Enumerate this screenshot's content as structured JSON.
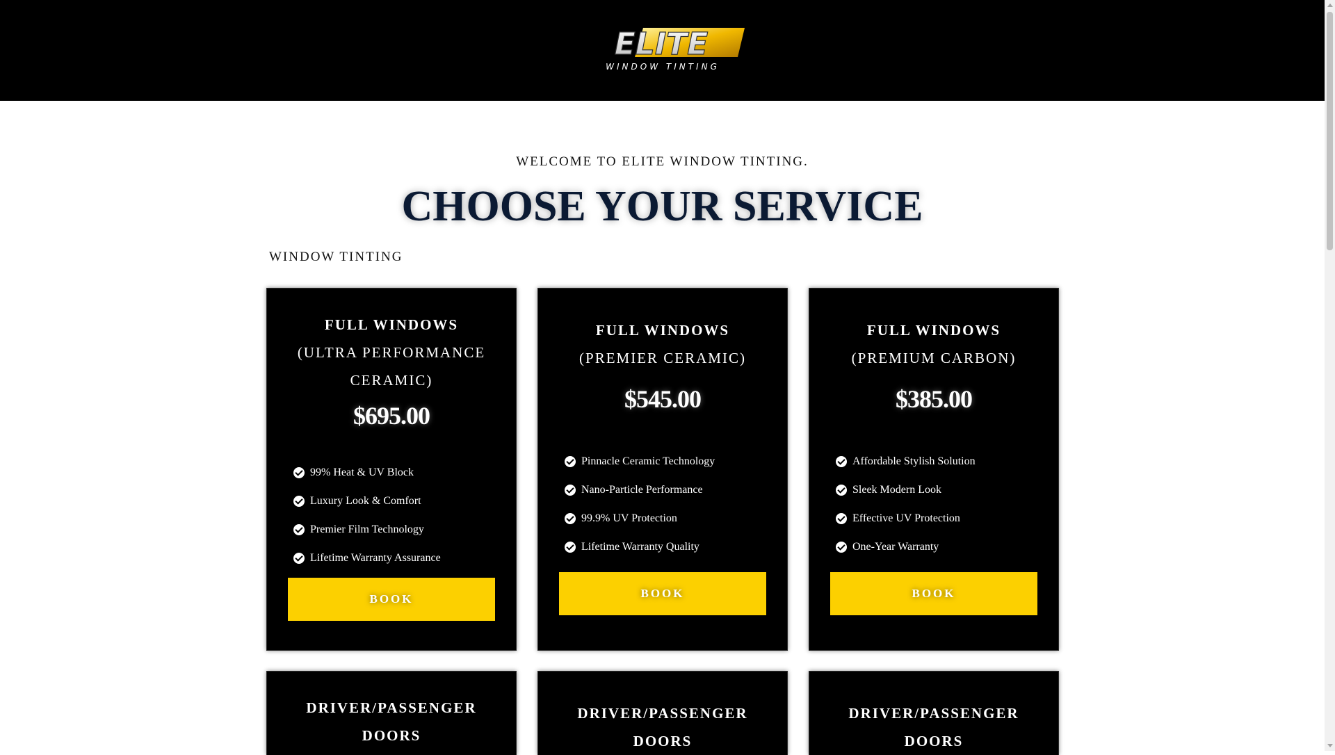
{
  "header": {
    "logo_text": "ELITE",
    "logo_subtext": "WINDOW TINTING"
  },
  "welcome": "WELCOME TO ELITE WINDOW TINTING.",
  "title": "CHOOSE YOUR SERVICE",
  "section_label": "WINDOW TINTING",
  "colors": {
    "header_bg": "#000000",
    "card_bg": "#000000",
    "button_bg": "#fcd000",
    "title_color": "#0b1a33"
  },
  "cards": [
    {
      "title": "FULL WINDOWS",
      "subtitle_line1": "(ULTRA PERFORMANCE",
      "subtitle_line2": "CERAMIC)",
      "price": "$695.00",
      "features": [
        "99% Heat & UV Block",
        "Luxury Look & Comfort",
        "Premier Film Technology",
        "Lifetime Warranty Assurance"
      ],
      "button": "BOOK"
    },
    {
      "title": "FULL WINDOWS",
      "subtitle_line1": "(PREMIER CERAMIC)",
      "price": "$545.00",
      "features": [
        "Pinnacle Ceramic Technology",
        "Nano-Particle Performance",
        "99.9% UV Protection",
        "Lifetime Warranty Quality"
      ],
      "button": "BOOK"
    },
    {
      "title": "FULL WINDOWS",
      "subtitle_line1": "(PREMIUM CARBON)",
      "price": "$385.00",
      "features": [
        "Affordable Stylish Solution",
        "Sleek Modern Look",
        "Effective UV Protection",
        "One-Year Warranty"
      ],
      "button": "BOOK"
    }
  ],
  "door_cards": [
    {
      "line1": "DRIVER/PASSENGER",
      "line2": "DOORS"
    },
    {
      "line1": "DRIVER/PASSENGER",
      "line2": "DOORS"
    },
    {
      "line1": "DRIVER/PASSENGER",
      "line2": "DOORS"
    }
  ]
}
